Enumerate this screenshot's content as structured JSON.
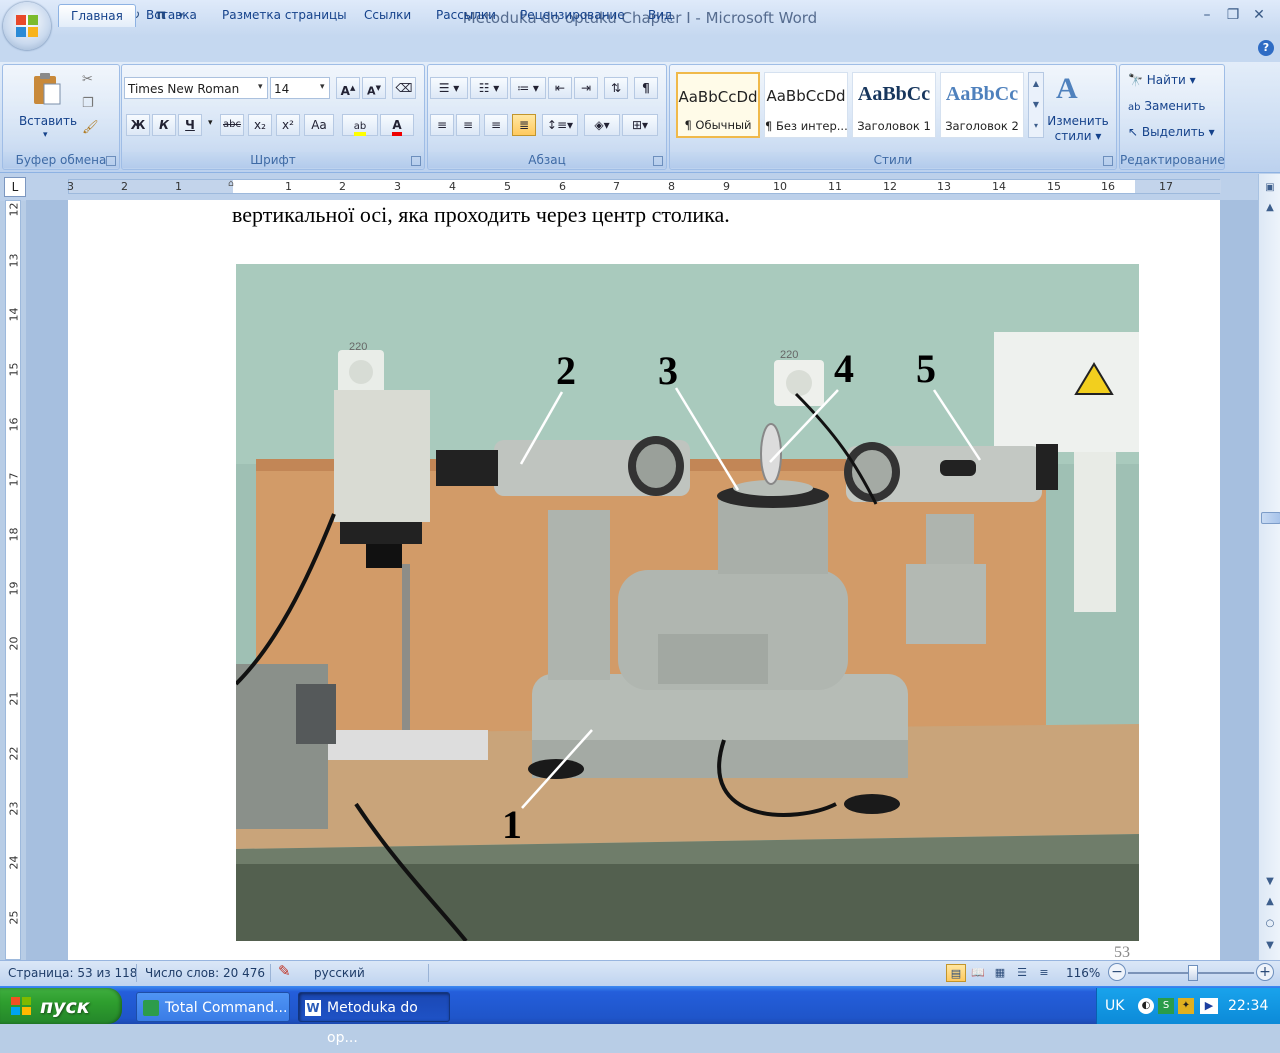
{
  "app": {
    "title": "Metoduka do optuku Chapter I - Microsoft Word",
    "quick_access": [
      "save-icon",
      "undo-icon",
      "redo-icon",
      "pi-icon",
      "customize-icon"
    ]
  },
  "ribbon": {
    "tabs": [
      "Главная",
      "Вставка",
      "Разметка страницы",
      "Ссылки",
      "Рассылки",
      "Рецензирование",
      "Вид"
    ],
    "active_tab": "Главная",
    "clipboard": {
      "paste_label": "Вставить",
      "group_label": "Буфер обмена"
    },
    "font": {
      "name": "Times New Roman",
      "size": "14",
      "group_label": "Шрифт",
      "buttons": [
        "Ж",
        "К",
        "Ч",
        "abc",
        "x₂",
        "x²",
        "Aa"
      ]
    },
    "paragraph": {
      "group_label": "Абзац"
    },
    "styles": {
      "group_label": "Стили",
      "change_label_1": "Изменить",
      "change_label_2": "стили",
      "items": [
        {
          "sample": "AaBbCcDd",
          "name": "¶ Обычный"
        },
        {
          "sample": "AaBbCcDd",
          "name": "¶ Без интер..."
        },
        {
          "sample": "AaBbCc",
          "name": "Заголовок 1"
        },
        {
          "sample": "AaBbCc",
          "name": "Заголовок 2"
        }
      ]
    },
    "editing": {
      "group_label": "Редактирование",
      "find": "Найти",
      "replace": "Заменить",
      "select": "Выделить"
    }
  },
  "document": {
    "text": "вертикальної осі, яка проходить через центр столика.",
    "page_number": "53",
    "photo": {
      "socket_label_left": "220",
      "socket_label_right": "220",
      "callouts": [
        "1",
        "2",
        "3",
        "4",
        "5"
      ]
    }
  },
  "ruler": {
    "h_left": [
      "3",
      "2",
      "1"
    ],
    "h_right": [
      "1",
      "2",
      "3",
      "4",
      "5",
      "6",
      "7",
      "8",
      "9",
      "10",
      "11",
      "12",
      "13",
      "14",
      "15",
      "16",
      "17"
    ],
    "v": [
      "12",
      "13",
      "14",
      "15",
      "16",
      "17",
      "18",
      "19",
      "20",
      "21",
      "22",
      "23",
      "24",
      "25"
    ]
  },
  "status": {
    "page": "Страница: 53 из 118",
    "words": "Число слов: 20 476",
    "language": "русский",
    "zoom": "116%"
  },
  "taskbar": {
    "start": "пуск",
    "tasks": [
      "Total Command...",
      "Metoduka do op..."
    ],
    "lang": "UK",
    "clock": "22:34"
  },
  "colors": {
    "ribbon_tab_text": "#15428b",
    "taskbar": "#245edb",
    "start": "#2e9e2e"
  }
}
